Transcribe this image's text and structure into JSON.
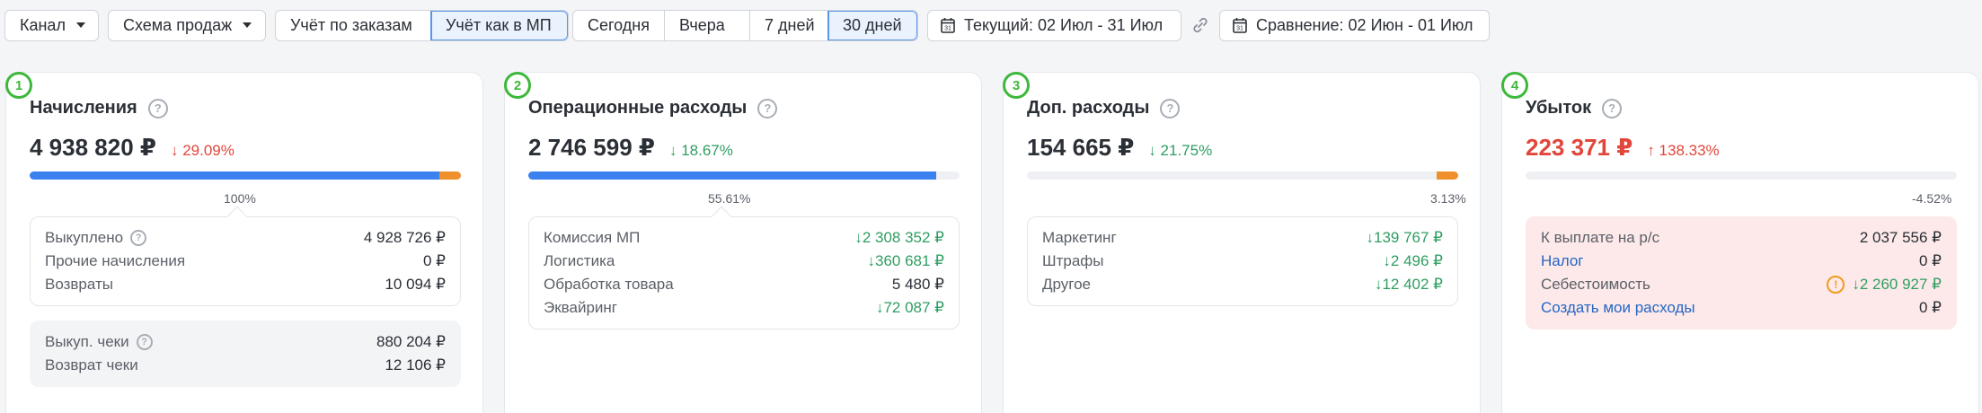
{
  "toolbar": {
    "channel": "Канал",
    "sales_scheme": "Схема продаж",
    "accounting": [
      {
        "label": "Учёт по заказам",
        "active": false
      },
      {
        "label": "Учёт как в МП",
        "active": true
      }
    ],
    "periods": [
      {
        "label": "Сегодня",
        "active": false
      },
      {
        "label": "Вчера",
        "active": false
      },
      {
        "label": "7 дней",
        "active": false
      },
      {
        "label": "30 дней",
        "active": true
      }
    ],
    "current_range": "Текущий: 02 Июл - 31 Июл",
    "compare_range": "Сравнение: 02 Июн - 01 Июл",
    "calendar_day": "31"
  },
  "cards": {
    "accruals": {
      "badge": "1",
      "title": "Начисления",
      "amount": "4 938 820 ₽",
      "delta": "29.09%",
      "delta_dir": "down",
      "bar_blue_fraction": 0.95,
      "bar_orange_fraction": 0.05,
      "bar_caption": "100%",
      "rows": [
        {
          "label": "Выкуплено",
          "value": "4 928 726 ₽"
        },
        {
          "label": "Прочие начисления",
          "value": "0 ₽"
        },
        {
          "label": "Возвраты",
          "value": "10 094 ₽"
        }
      ],
      "checks": [
        {
          "label": "Выкуп. чеки",
          "value": "880 204 ₽"
        },
        {
          "label": "Возврат чеки",
          "value": "12 106 ₽"
        }
      ]
    },
    "operational": {
      "badge": "2",
      "title": "Операционные расходы",
      "amount": "2 746 599 ₽",
      "delta": "18.67%",
      "delta_dir": "down",
      "bar_blue_fraction": 0.9461,
      "bar_caption": "55.61%",
      "rows": [
        {
          "label": "Комиссия МП",
          "value": "2 308 352 ₽",
          "arrow": "down"
        },
        {
          "label": "Логистика",
          "value": "360 681 ₽",
          "arrow": "down"
        },
        {
          "label": "Обработка товара",
          "value": "5 480 ₽"
        },
        {
          "label": "Эквайринг",
          "value": "72 087 ₽",
          "arrow": "down"
        }
      ]
    },
    "extra": {
      "badge": "3",
      "title": "Доп. расходы",
      "amount": "154 665 ₽",
      "delta": "21.75%",
      "delta_dir": "down",
      "bar_orange_fraction": 0.05,
      "bar_caption": "3.13%",
      "rows": [
        {
          "label": "Маркетинг",
          "value": "139 767 ₽",
          "arrow": "down"
        },
        {
          "label": "Штрафы",
          "value": "2 496 ₽",
          "arrow": "down"
        },
        {
          "label": "Другое",
          "value": "12 402 ₽",
          "arrow": "down"
        }
      ]
    },
    "loss": {
      "badge": "4",
      "title": "Убыток",
      "amount": "223 371 ₽",
      "delta": "138.33%",
      "delta_dir": "up",
      "bar_caption": "-4.52%",
      "rows": [
        {
          "label": "К выплате на р/с",
          "value": "2 037 556 ₽"
        },
        {
          "label": "Налог",
          "value": "0 ₽",
          "link": true
        },
        {
          "label": "Себестоимость",
          "value": "2 260 927 ₽",
          "arrow": "down",
          "warning": true
        },
        {
          "label": "Создать мои расходы",
          "value": "0 ₽",
          "link": true
        }
      ]
    }
  },
  "colors": {
    "blue": "#3b82f0",
    "orange": "#f0902c",
    "green": "#2f9e62",
    "red": "#e2463a",
    "badge": "#3db83b"
  },
  "icons": {
    "help": "?",
    "warning": "!",
    "arrow_down": "↓",
    "arrow_up": "↑"
  }
}
